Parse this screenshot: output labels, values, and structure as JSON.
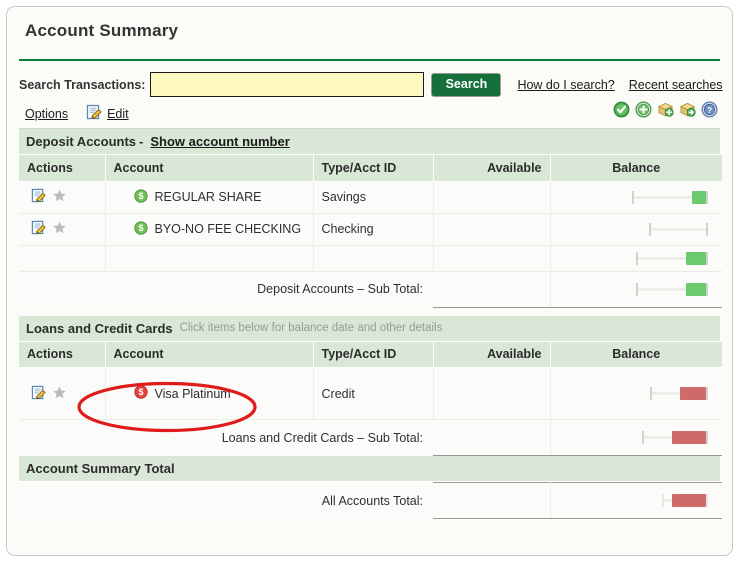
{
  "page": {
    "title": "Account Summary",
    "accent_green": "#0a7a3d",
    "section_bg": "#d9e7d7",
    "positive_color": "#6dc96d",
    "negative_color": "#d06a6a",
    "annotation_color": "#e01b1b"
  },
  "search": {
    "label": "Search Transactions:",
    "value": "",
    "placeholder": "",
    "button_label": "Search",
    "links": [
      {
        "label": "How do I search?",
        "name": "how-do-i-search-link"
      },
      {
        "label": "Recent searches",
        "name": "recent-searches-link"
      }
    ]
  },
  "options_row": {
    "options_label": "Options",
    "edit_label": "Edit",
    "edit_icon": "notepad-pencil-icon",
    "toolbar_icons": [
      {
        "name": "check-circle-icon",
        "title": "check"
      },
      {
        "name": "plus-circle-icon",
        "title": "add"
      },
      {
        "name": "box-add-icon",
        "title": "add to box"
      },
      {
        "name": "box-export-icon",
        "title": "export box"
      },
      {
        "name": "help-circle-icon",
        "title": "help"
      }
    ]
  },
  "columns": {
    "actions": "Actions",
    "account": "Account",
    "type": "Type/Acct ID",
    "available": "Available",
    "balance": "Balance"
  },
  "deposit_section": {
    "title": "Deposit Accounts",
    "dash": "-",
    "link_label": "Show account number",
    "rows": [
      {
        "account": "REGULAR SHARE",
        "type": "Savings",
        "available": "",
        "balance_redacted": true,
        "balance_sign": "positive",
        "icon": "dollar-circle-green-icon",
        "action_icons": [
          "notepad-pencil-icon",
          "star-icon"
        ]
      },
      {
        "account": "BYO-NO FEE CHECKING",
        "type": "Checking",
        "available": "",
        "balance_redacted": true,
        "balance_sign": "neutral",
        "icon": "dollar-circle-green-icon",
        "action_icons": [
          "notepad-pencil-icon",
          "star-icon"
        ]
      }
    ],
    "spacer_row_balance_sign": "positive",
    "subtotal_label": "Deposit Accounts – Sub Total:",
    "subtotal_sign": "positive"
  },
  "loans_section": {
    "title": "Loans and Credit Cards",
    "hint": "Click items below for balance date and other details",
    "rows": [
      {
        "account": "Visa Platinum",
        "type": "Credit",
        "available": "",
        "balance_redacted": true,
        "balance_sign": "negative",
        "icon": "dollar-circle-red-icon",
        "action_icons": [
          "notepad-pencil-icon",
          "star-icon"
        ],
        "annotated": true
      }
    ],
    "subtotal_label": "Loans and Credit Cards – Sub Total:",
    "subtotal_sign": "negative"
  },
  "summary_section": {
    "title": "Account Summary Total",
    "total_label": "All Accounts Total:",
    "total_sign": "negative"
  }
}
